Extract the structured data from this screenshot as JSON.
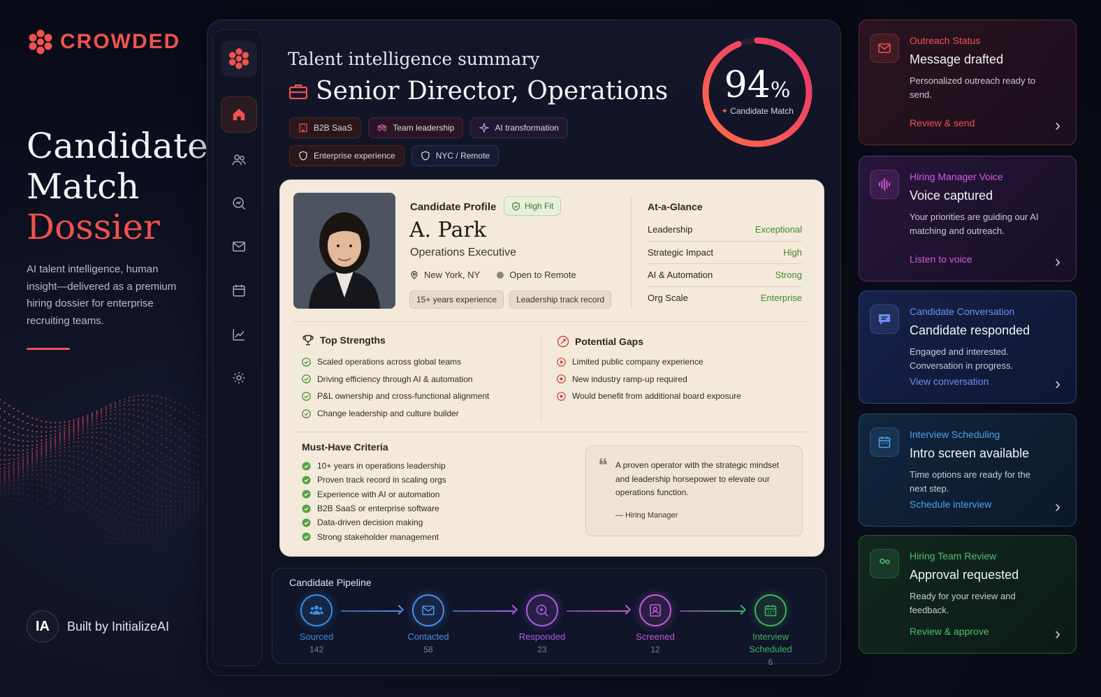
{
  "brand": {
    "name": "CROWDED"
  },
  "hero": {
    "line1": "Candidate",
    "line2": "Match",
    "line3": "Dossier",
    "description": "AI talent intelligence, human insight—delivered as a premium hiring dossier for enterprise recruiting teams."
  },
  "footer": {
    "badge": "IA",
    "text": "Built by InitializeAI"
  },
  "summary": {
    "label": "Talent intelligence summary",
    "job_title": "Senior Director, Operations",
    "chips": [
      "B2B SaaS",
      "Team leadership",
      "AI transformation",
      "Enterprise experience",
      "NYC / Remote"
    ]
  },
  "match": {
    "value": 94,
    "value_text": "94",
    "unit": "%",
    "label": "Candidate Match"
  },
  "profile": {
    "section_label": "Candidate Profile",
    "fit_badge": "High Fit",
    "name": "A. Park",
    "role": "Operations Executive",
    "location": "New York, NY",
    "availability": "Open to Remote",
    "tags": [
      "15+ years experience",
      "Leadership track record"
    ]
  },
  "glance": {
    "title": "At-a-Glance",
    "rows": [
      {
        "label": "Leadership",
        "value": "Exceptional"
      },
      {
        "label": "Strategic Impact",
        "value": "High"
      },
      {
        "label": "AI & Automation",
        "value": "Strong"
      },
      {
        "label": "Org Scale",
        "value": "Enterprise"
      }
    ]
  },
  "strengths": {
    "title": "Top Strengths",
    "items": [
      "Scaled operations across global teams",
      "Driving efficiency through AI & automation",
      "P&L ownership and cross-functional alignment",
      "Change leadership and culture builder"
    ]
  },
  "gaps": {
    "title": "Potential Gaps",
    "items": [
      "Limited public company experience",
      "New industry ramp-up required",
      "Would benefit from additional board exposure"
    ]
  },
  "criteria": {
    "title": "Must-Have Criteria",
    "items": [
      "10+ years in operations leadership",
      "Proven track record in scaling orgs",
      "Experience with AI or automation",
      "B2B SaaS or enterprise software",
      "Data-driven decision making",
      "Strong stakeholder management"
    ]
  },
  "quote": {
    "text": "A proven operator with the strategic mindset and leadership horsepower to elevate our operations function.",
    "attribution": "— Hiring Manager"
  },
  "pipeline": {
    "title": "Candidate Pipeline",
    "stages": [
      {
        "label": "Sourced",
        "count": "142",
        "color": "#3b8fe0"
      },
      {
        "label": "Contacted",
        "count": "58",
        "color": "#4d8ee6"
      },
      {
        "label": "Responded",
        "count": "23",
        "color": "#b25be8"
      },
      {
        "label": "Screened",
        "count": "12",
        "color": "#c05cd6"
      },
      {
        "label": "Interview Scheduled",
        "count": "6",
        "color": "#3fb45a"
      }
    ]
  },
  "status_cards": [
    {
      "kicker": "Outreach Status",
      "title": "Message drafted",
      "desc": "Personalized outreach ready to send.",
      "link": "Review & send",
      "accent": "#f0524d",
      "icon": "mail-icon"
    },
    {
      "kicker": "Hiring Manager Voice",
      "title": "Voice captured",
      "desc": "Your priorities are guiding our AI matching and outreach.",
      "link": "Listen to voice",
      "accent": "#d35de0",
      "icon": "waveform-icon"
    },
    {
      "kicker": "Candidate Conversation",
      "title": "Candidate responded",
      "desc": "Engaged and interested. Conversation in progress.",
      "link": "View conversation",
      "accent": "#6d8ff0",
      "icon": "chat-icon"
    },
    {
      "kicker": "Interview Scheduling",
      "title": "Intro screen available",
      "desc": "Time options are ready for the next step.",
      "link": "Schedule interview",
      "accent": "#4aa3e8",
      "icon": "calendar-icon"
    },
    {
      "kicker": "Hiring Team Review",
      "title": "Approval requested",
      "desc": "Ready for your review and feedback.",
      "link": "Review & approve",
      "accent": "#4fc06a",
      "icon": "team-icon"
    }
  ]
}
